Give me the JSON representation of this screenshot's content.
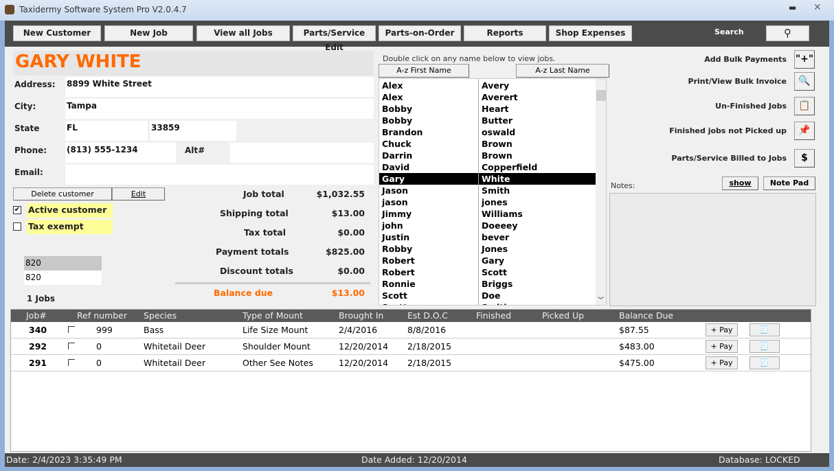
{
  "window": {
    "title": "Taxidermy Software System Pro V2.0.4.7"
  },
  "toolbar": {
    "buttons": [
      "New Customer",
      "New Job",
      "View all Jobs",
      "Parts/Service Edit",
      "Parts-on-Order",
      "Reports",
      "Shop Expenses"
    ],
    "search_label": "Search"
  },
  "customer": {
    "name": "GARY WHITE",
    "address_label": "Address:",
    "address": "8899 White Street",
    "city_label": "City:",
    "city": "Tampa",
    "state_label": "State",
    "state": "FL",
    "zip": "33859",
    "phone_label": "Phone:",
    "phone": "(813) 555-1234",
    "alt_label": "Alt#",
    "alt": "",
    "email_label": "Email:",
    "email": "",
    "delete_label": "Delete customer",
    "edit_label": "Edit",
    "active_label": "Active customer",
    "active": true,
    "tax_exempt_label": "Tax exempt",
    "tax_exempt": false,
    "code1": "820",
    "code2": "820",
    "jobs_count": "1 Jobs"
  },
  "totals": {
    "job_total_label": "Job total",
    "job_total": "$1,032.55",
    "shipping_label": "Shipping total",
    "shipping": "$13.00",
    "tax_label": "Tax total",
    "tax": "$0.00",
    "payment_label": "Payment totals",
    "payment": "$825.00",
    "discount_label": "Discount totals",
    "discount": "$0.00",
    "balance_label": "Balance due",
    "balance": "$13.00"
  },
  "names": {
    "hint": "Double click on any name below to view jobs.",
    "sort_first": "A-z First Name",
    "sort_last": "A-z Last Name",
    "selected_index": 8,
    "rows": [
      [
        "Alex",
        "Avery"
      ],
      [
        "Alex",
        "Averert"
      ],
      [
        "Bobby",
        "Heart"
      ],
      [
        "Bobby",
        "Butter"
      ],
      [
        "Brandon",
        "oswald"
      ],
      [
        "Chuck",
        "Brown"
      ],
      [
        "Darrin",
        "Brown"
      ],
      [
        "David",
        "Copperfield"
      ],
      [
        "Gary",
        "White"
      ],
      [
        "Jason",
        "Smith"
      ],
      [
        "jason",
        "jones"
      ],
      [
        "Jimmy",
        "Williams"
      ],
      [
        "john",
        "Doeeey"
      ],
      [
        "Justin",
        "bever"
      ],
      [
        "Robby",
        "Jones"
      ],
      [
        "Robert",
        "Gary"
      ],
      [
        "Robert",
        "Scott"
      ],
      [
        "Ronnie",
        "Briggs"
      ],
      [
        "Scott",
        "Doe"
      ],
      [
        "Scott",
        "Smith"
      ]
    ]
  },
  "side": {
    "add_bulk": "Add Bulk Payments",
    "print_bulk": "Print/View Bulk Invoice",
    "unfinished": "Un-Finished Jobs",
    "finished_not_picked": "Finished jobs not Picked up",
    "parts_billed": "Parts/Service Billed to Jobs",
    "add_icon": "\"+\"",
    "dollar_icon": "$",
    "notes_label": "Notes:",
    "show_label": "show",
    "notepad_label": "Note Pad"
  },
  "jobs": {
    "headers": [
      "Job#",
      "Ref number",
      "Species",
      "Type of Mount",
      "Brought In",
      "Est D.O.C",
      "Finished",
      "Picked Up",
      "Balance Due"
    ],
    "pay_label": "+ Pay",
    "rows": [
      {
        "job": "340",
        "ref": "999",
        "species": "Bass",
        "mount": "Life Size Mount",
        "in": "2/4/2016",
        "doc": "8/8/2016",
        "finished": "",
        "picked": "",
        "balance": "$87.55"
      },
      {
        "job": "292",
        "ref": "0",
        "species": "Whitetail Deer",
        "mount": "Shoulder Mount",
        "in": "12/20/2014",
        "doc": "2/18/2015",
        "finished": "",
        "picked": "",
        "balance": "$483.00"
      },
      {
        "job": "291",
        "ref": "0",
        "species": "Whitetail Deer",
        "mount": "Other See Notes",
        "in": "12/20/2014",
        "doc": "2/18/2015",
        "finished": "",
        "picked": "",
        "balance": "$475.00"
      }
    ]
  },
  "status": {
    "date": "Date: 2/4/2023 3:35:49 PM",
    "date_added": "Date Added:  12/20/2014",
    "database": "Database: LOCKED"
  },
  "colors": {
    "accent": "#ff6a00",
    "toolbar": "#4b4b4b",
    "highlight": "#ffff99"
  }
}
